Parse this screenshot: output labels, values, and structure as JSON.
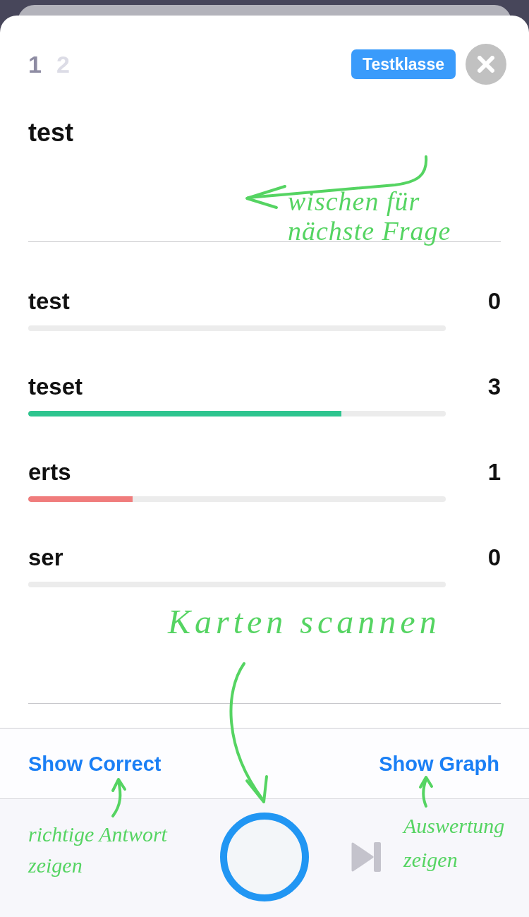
{
  "page_indicator": [
    {
      "label": "1",
      "selected": true
    },
    {
      "label": "2",
      "selected": false
    }
  ],
  "class_tag": "Testklasse",
  "question": "test",
  "answers": [
    {
      "label": "test",
      "count": "0",
      "level": 0
    },
    {
      "label": "teset",
      "count": "3",
      "level": 0.75,
      "color": "#2ec58f"
    },
    {
      "label": "erts",
      "count": "1",
      "level": 0.25,
      "color": "#f07c7c"
    },
    {
      "label": "ser",
      "count": "0",
      "level": 0
    }
  ],
  "actions": [
    {
      "label": "Show Correct"
    },
    {
      "label": "Show Graph"
    }
  ],
  "annotations": [
    {
      "text": "wischen für nächste Frage"
    },
    {
      "text": "Karten scannen"
    },
    {
      "text": "richtige Antwort zeigen"
    },
    {
      "text": "Auswertung zeigen"
    }
  ]
}
